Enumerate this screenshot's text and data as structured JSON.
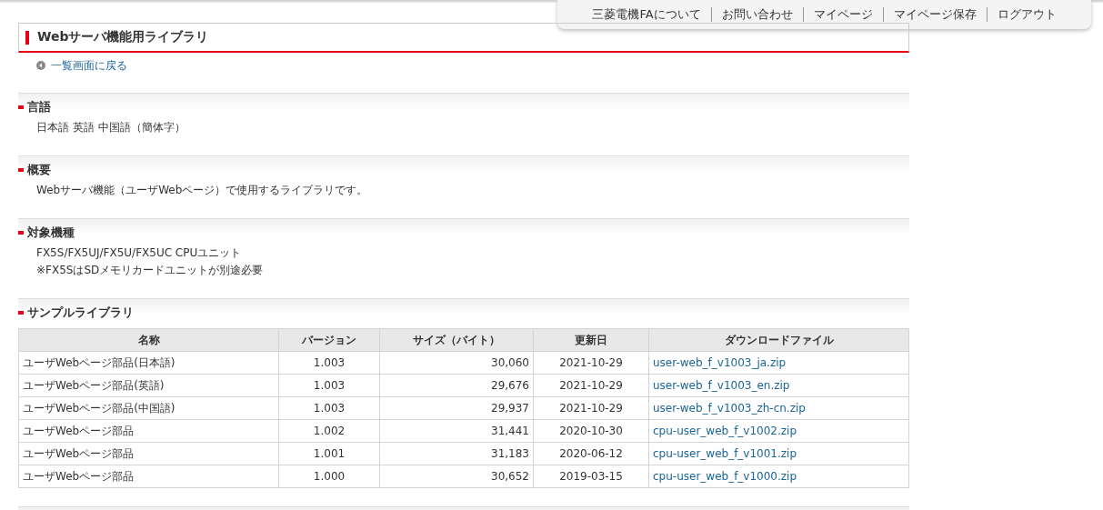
{
  "top_nav": [
    "三菱電機FAについて",
    "お問い合わせ",
    "マイページ",
    "マイページ保存",
    "ログアウト"
  ],
  "page_title": "Webサーバ機能用ライブラリ",
  "back_link": "一覧画面に戻る",
  "sections": [
    {
      "kind": "text",
      "heading": "言語",
      "lines": [
        "日本語 英語 中国語（簡体字）"
      ]
    },
    {
      "kind": "text",
      "heading": "概要",
      "lines": [
        "Webサーバ機能（ユーザWebページ）で使用するライブラリです。"
      ]
    },
    {
      "kind": "text",
      "heading": "対象機種",
      "lines": [
        "FX5S/FX5UJ/FX5U/FX5UC CPUユニット",
        "※FX5SはSDメモリカードユニットが別途必要"
      ]
    },
    {
      "kind": "table",
      "heading": "サンプルライブラリ",
      "columns": [
        "名称",
        "バージョン",
        "サイズ（バイト）",
        "更新日",
        "ダウンロードファイル"
      ],
      "rows": [
        [
          "ユーザWebページ部品(日本語)",
          "1.003",
          "30,060",
          "2021-10-29",
          "user-web_f_v1003_ja.zip"
        ],
        [
          "ユーザWebページ部品(英語)",
          "1.003",
          "29,676",
          "2021-10-29",
          "user-web_f_v1003_en.zip"
        ],
        [
          "ユーザWebページ部品(中国語)",
          "1.003",
          "29,937",
          "2021-10-29",
          "user-web_f_v1003_zh-cn.zip"
        ],
        [
          "ユーザWebページ部品",
          "1.002",
          "31,441",
          "2020-10-30",
          "cpu-user_web_f_v1002.zip"
        ],
        [
          "ユーザWebページ部品",
          "1.001",
          "31,183",
          "2020-06-12",
          "cpu-user_web_f_v1001.zip"
        ],
        [
          "ユーザWebページ部品",
          "1.000",
          "30,652",
          "2019-03-15",
          "cpu-user_web_f_v1000.zip"
        ]
      ]
    }
  ]
}
